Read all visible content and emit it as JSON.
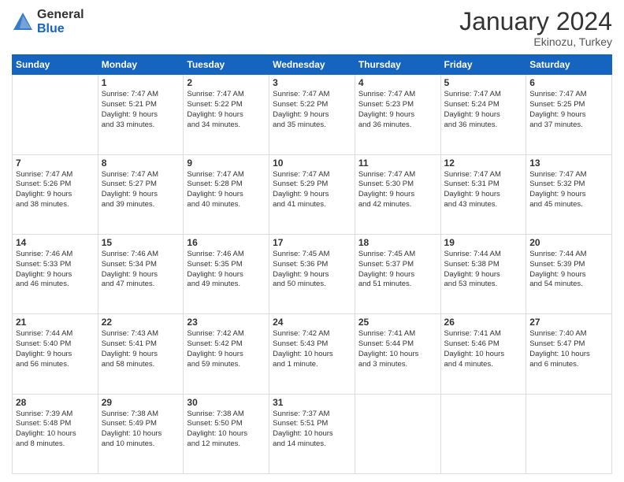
{
  "header": {
    "logo_general": "General",
    "logo_blue": "Blue",
    "title": "January 2024",
    "subtitle": "Ekinozu, Turkey"
  },
  "calendar": {
    "headers": [
      "Sunday",
      "Monday",
      "Tuesday",
      "Wednesday",
      "Thursday",
      "Friday",
      "Saturday"
    ],
    "weeks": [
      [
        {
          "day": "",
          "info": ""
        },
        {
          "day": "1",
          "info": "Sunrise: 7:47 AM\nSunset: 5:21 PM\nDaylight: 9 hours\nand 33 minutes."
        },
        {
          "day": "2",
          "info": "Sunrise: 7:47 AM\nSunset: 5:22 PM\nDaylight: 9 hours\nand 34 minutes."
        },
        {
          "day": "3",
          "info": "Sunrise: 7:47 AM\nSunset: 5:22 PM\nDaylight: 9 hours\nand 35 minutes."
        },
        {
          "day": "4",
          "info": "Sunrise: 7:47 AM\nSunset: 5:23 PM\nDaylight: 9 hours\nand 36 minutes."
        },
        {
          "day": "5",
          "info": "Sunrise: 7:47 AM\nSunset: 5:24 PM\nDaylight: 9 hours\nand 36 minutes."
        },
        {
          "day": "6",
          "info": "Sunrise: 7:47 AM\nSunset: 5:25 PM\nDaylight: 9 hours\nand 37 minutes."
        }
      ],
      [
        {
          "day": "7",
          "info": "Sunrise: 7:47 AM\nSunset: 5:26 PM\nDaylight: 9 hours\nand 38 minutes."
        },
        {
          "day": "8",
          "info": "Sunrise: 7:47 AM\nSunset: 5:27 PM\nDaylight: 9 hours\nand 39 minutes."
        },
        {
          "day": "9",
          "info": "Sunrise: 7:47 AM\nSunset: 5:28 PM\nDaylight: 9 hours\nand 40 minutes."
        },
        {
          "day": "10",
          "info": "Sunrise: 7:47 AM\nSunset: 5:29 PM\nDaylight: 9 hours\nand 41 minutes."
        },
        {
          "day": "11",
          "info": "Sunrise: 7:47 AM\nSunset: 5:30 PM\nDaylight: 9 hours\nand 42 minutes."
        },
        {
          "day": "12",
          "info": "Sunrise: 7:47 AM\nSunset: 5:31 PM\nDaylight: 9 hours\nand 43 minutes."
        },
        {
          "day": "13",
          "info": "Sunrise: 7:47 AM\nSunset: 5:32 PM\nDaylight: 9 hours\nand 45 minutes."
        }
      ],
      [
        {
          "day": "14",
          "info": "Sunrise: 7:46 AM\nSunset: 5:33 PM\nDaylight: 9 hours\nand 46 minutes."
        },
        {
          "day": "15",
          "info": "Sunrise: 7:46 AM\nSunset: 5:34 PM\nDaylight: 9 hours\nand 47 minutes."
        },
        {
          "day": "16",
          "info": "Sunrise: 7:46 AM\nSunset: 5:35 PM\nDaylight: 9 hours\nand 49 minutes."
        },
        {
          "day": "17",
          "info": "Sunrise: 7:45 AM\nSunset: 5:36 PM\nDaylight: 9 hours\nand 50 minutes."
        },
        {
          "day": "18",
          "info": "Sunrise: 7:45 AM\nSunset: 5:37 PM\nDaylight: 9 hours\nand 51 minutes."
        },
        {
          "day": "19",
          "info": "Sunrise: 7:44 AM\nSunset: 5:38 PM\nDaylight: 9 hours\nand 53 minutes."
        },
        {
          "day": "20",
          "info": "Sunrise: 7:44 AM\nSunset: 5:39 PM\nDaylight: 9 hours\nand 54 minutes."
        }
      ],
      [
        {
          "day": "21",
          "info": "Sunrise: 7:44 AM\nSunset: 5:40 PM\nDaylight: 9 hours\nand 56 minutes."
        },
        {
          "day": "22",
          "info": "Sunrise: 7:43 AM\nSunset: 5:41 PM\nDaylight: 9 hours\nand 58 minutes."
        },
        {
          "day": "23",
          "info": "Sunrise: 7:42 AM\nSunset: 5:42 PM\nDaylight: 9 hours\nand 59 minutes."
        },
        {
          "day": "24",
          "info": "Sunrise: 7:42 AM\nSunset: 5:43 PM\nDaylight: 10 hours\nand 1 minute."
        },
        {
          "day": "25",
          "info": "Sunrise: 7:41 AM\nSunset: 5:44 PM\nDaylight: 10 hours\nand 3 minutes."
        },
        {
          "day": "26",
          "info": "Sunrise: 7:41 AM\nSunset: 5:46 PM\nDaylight: 10 hours\nand 4 minutes."
        },
        {
          "day": "27",
          "info": "Sunrise: 7:40 AM\nSunset: 5:47 PM\nDaylight: 10 hours\nand 6 minutes."
        }
      ],
      [
        {
          "day": "28",
          "info": "Sunrise: 7:39 AM\nSunset: 5:48 PM\nDaylight: 10 hours\nand 8 minutes."
        },
        {
          "day": "29",
          "info": "Sunrise: 7:38 AM\nSunset: 5:49 PM\nDaylight: 10 hours\nand 10 minutes."
        },
        {
          "day": "30",
          "info": "Sunrise: 7:38 AM\nSunset: 5:50 PM\nDaylight: 10 hours\nand 12 minutes."
        },
        {
          "day": "31",
          "info": "Sunrise: 7:37 AM\nSunset: 5:51 PM\nDaylight: 10 hours\nand 14 minutes."
        },
        {
          "day": "",
          "info": ""
        },
        {
          "day": "",
          "info": ""
        },
        {
          "day": "",
          "info": ""
        }
      ]
    ]
  }
}
